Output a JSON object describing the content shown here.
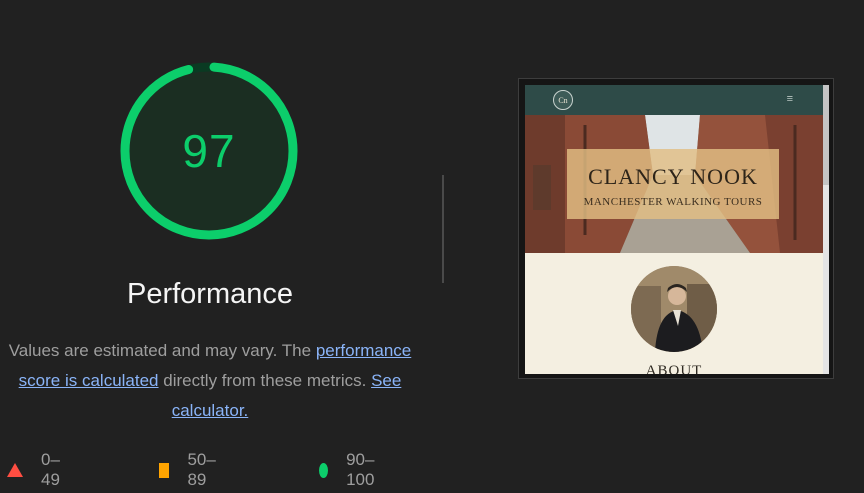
{
  "gauge": {
    "score": "97",
    "fraction": 0.97,
    "color": "#0cce6b",
    "track_color": "#0a3a22"
  },
  "category": {
    "title": "Performance"
  },
  "description": {
    "text_before": "Values are estimated and may vary. The ",
    "link1": "performance score is calculated",
    "text_middle": " directly from these metrics. ",
    "link2": "See calculator."
  },
  "legend": [
    {
      "range": "0–49",
      "shape": "triangle",
      "color": "#ff4e42"
    },
    {
      "range": "50–89",
      "shape": "square",
      "color": "#ffa400"
    },
    {
      "range": "90–100",
      "shape": "circle",
      "color": "#0cce6b"
    }
  ],
  "screenshot": {
    "logo_text": "Cn",
    "menu_icon": "hamburger-icon",
    "hero_title": "CLANCY NOOK",
    "hero_subtitle": "MANCHESTER WALKING TOURS",
    "about_heading": "ABOUT"
  }
}
